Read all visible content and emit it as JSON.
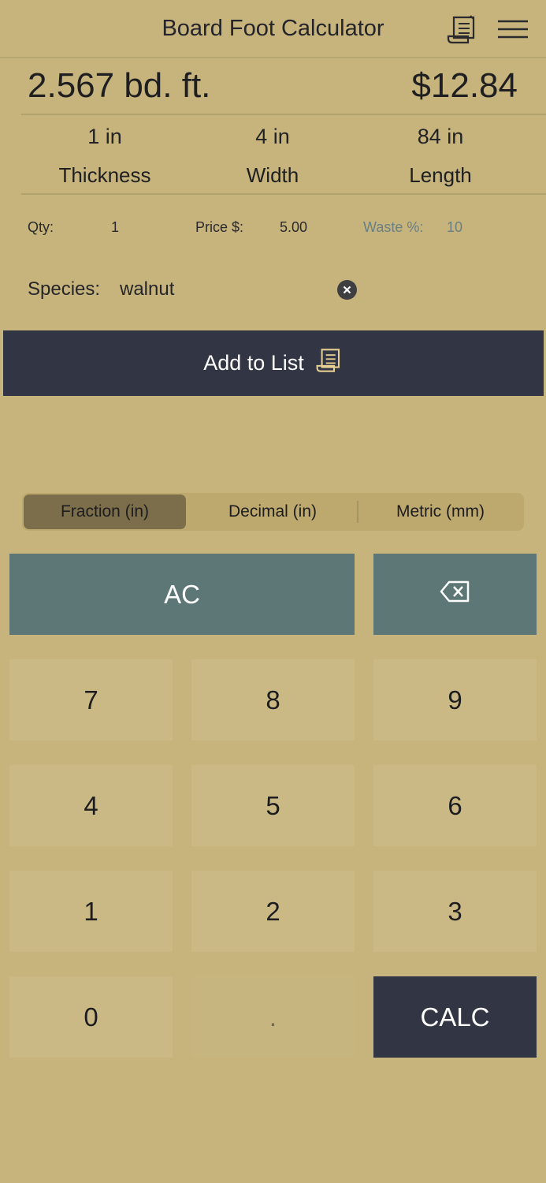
{
  "header": {
    "title": "Board Foot Calculator",
    "receipt_icon": "receipt-icon",
    "menu_icon": "hamburger-menu-icon"
  },
  "result": {
    "board_feet": "2.567 bd. ft.",
    "price": "$12.84"
  },
  "dimensions": [
    {
      "value": "1 in",
      "label": "Thickness"
    },
    {
      "value": "4 in",
      "label": "Width"
    },
    {
      "value": "84 in",
      "label": "Length"
    }
  ],
  "fields": {
    "qty_label": "Qty:",
    "qty_value": "1",
    "price_label": "Price $:",
    "price_value": "5.00",
    "waste_label": "Waste %:",
    "waste_value": "10"
  },
  "species": {
    "label": "Species:",
    "value": "walnut"
  },
  "add_button": {
    "label": "Add to List"
  },
  "units": {
    "options": [
      "Fraction (in)",
      "Decimal (in)",
      "Metric (mm)"
    ],
    "selected": "Fraction (in)"
  },
  "keypad": {
    "clear": "AC",
    "digits": [
      "7",
      "8",
      "9",
      "4",
      "5",
      "6",
      "1",
      "2",
      "3",
      "0"
    ],
    "dot": ".",
    "calc": "CALC"
  },
  "colors": {
    "background": "#c6b47c",
    "dark_button": "#323544",
    "gray_button": "#5d7777",
    "key_bg": "#cbb985",
    "segment_active": "#7c6e4b"
  }
}
